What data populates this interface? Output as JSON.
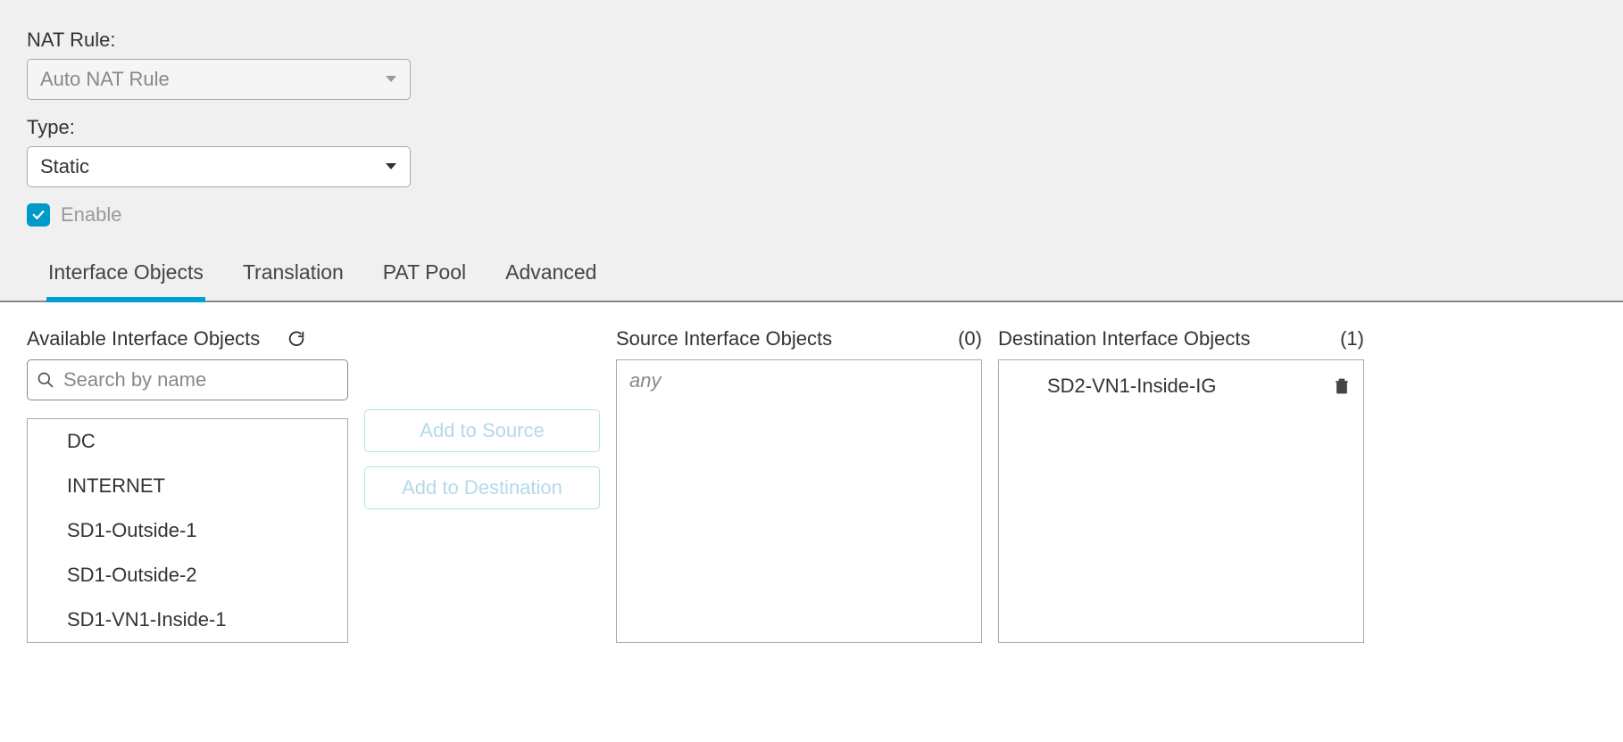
{
  "natRule": {
    "label": "NAT Rule:",
    "value": "Auto NAT Rule"
  },
  "type": {
    "label": "Type:",
    "value": "Static"
  },
  "enable": {
    "label": "Enable",
    "checked": true
  },
  "tabs": {
    "interfaceObjects": "Interface Objects",
    "translation": "Translation",
    "patPool": "PAT Pool",
    "advanced": "Advanced"
  },
  "available": {
    "header": "Available Interface Objects",
    "searchPlaceholder": "Search by name",
    "items": [
      "DC",
      "INTERNET",
      "SD1-Outside-1",
      "SD1-Outside-2",
      "SD1-VN1-Inside-1"
    ]
  },
  "buttons": {
    "addToSource": "Add to Source",
    "addToDestination": "Add to Destination"
  },
  "source": {
    "header": "Source Interface Objects",
    "count": "(0)",
    "placeholder": "any"
  },
  "destination": {
    "header": "Destination Interface Objects",
    "count": "(1)",
    "items": [
      "SD2-VN1-Inside-IG"
    ]
  }
}
